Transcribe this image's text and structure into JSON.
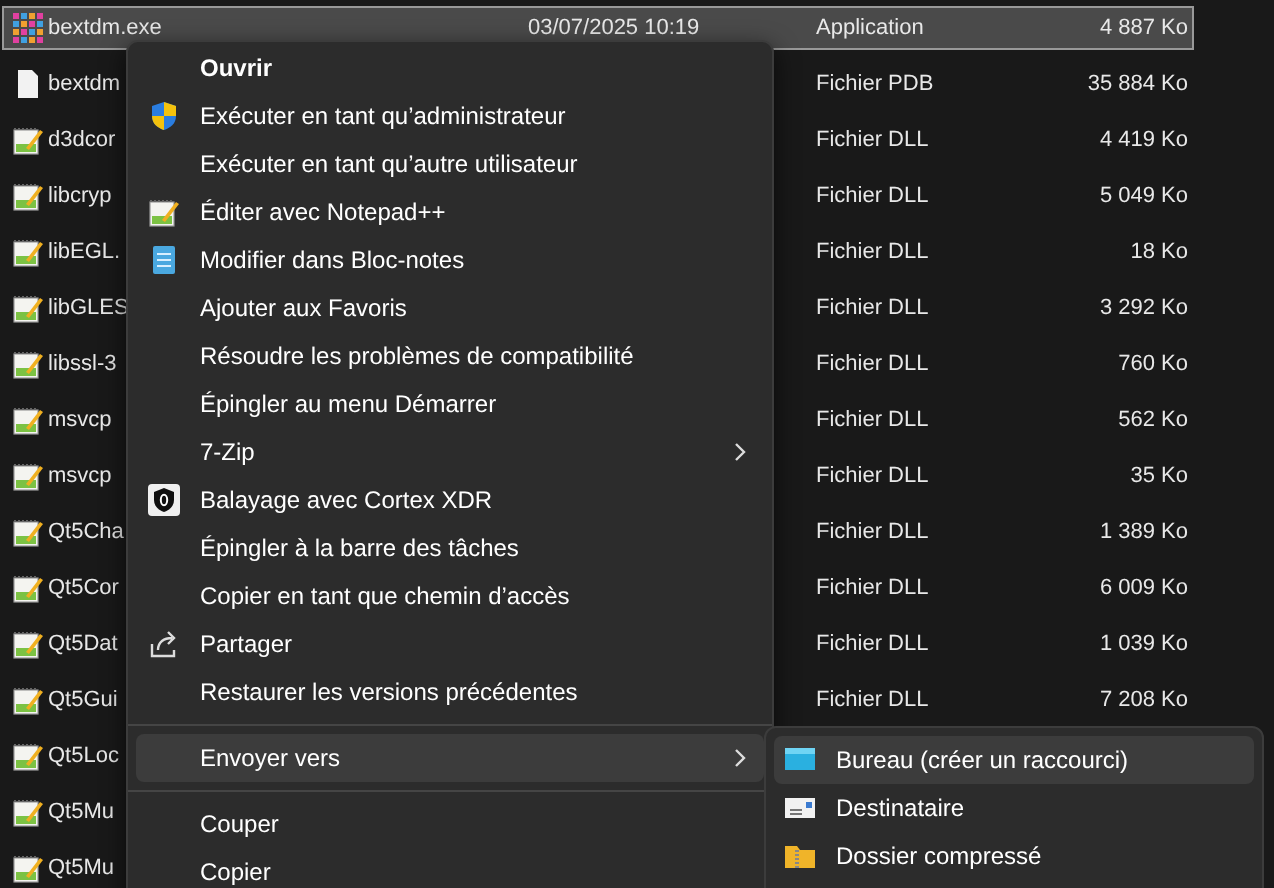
{
  "files": [
    {
      "kind": "exe",
      "name": "bextdm.exe",
      "date": "03/07/2025 10:19",
      "type": "Application",
      "size": "4 887 Ko",
      "selected": true
    },
    {
      "kind": "document",
      "name": "bextdm",
      "type": "Fichier PDB",
      "size": "35 884 Ko",
      "selected": false
    },
    {
      "kind": "notepadpp",
      "name": "d3dcor",
      "type": "Fichier DLL",
      "size": "4 419 Ko",
      "selected": false
    },
    {
      "kind": "notepadpp",
      "name": "libcryp",
      "type": "Fichier DLL",
      "size": "5 049 Ko",
      "selected": false
    },
    {
      "kind": "notepadpp",
      "name": "libEGL.",
      "type": "Fichier DLL",
      "size": "18 Ko",
      "selected": false
    },
    {
      "kind": "notepadpp",
      "name": "libGLES",
      "type": "Fichier DLL",
      "size": "3 292 Ko",
      "selected": false
    },
    {
      "kind": "notepadpp",
      "name": "libssl-3",
      "type": "Fichier DLL",
      "size": "760 Ko",
      "selected": false
    },
    {
      "kind": "notepadpp",
      "name": "msvcp",
      "type": "Fichier DLL",
      "size": "562 Ko",
      "selected": false
    },
    {
      "kind": "notepadpp",
      "name": "msvcp",
      "type": "Fichier DLL",
      "size": "35 Ko",
      "selected": false
    },
    {
      "kind": "notepadpp",
      "name": "Qt5Cha",
      "type": "Fichier DLL",
      "size": "1 389 Ko",
      "selected": false
    },
    {
      "kind": "notepadpp",
      "name": "Qt5Cor",
      "type": "Fichier DLL",
      "size": "6 009 Ko",
      "selected": false
    },
    {
      "kind": "notepadpp",
      "name": "Qt5Dat",
      "type": "Fichier DLL",
      "size": "1 039 Ko",
      "selected": false
    },
    {
      "kind": "notepadpp",
      "name": "Qt5Gui",
      "type": "Fichier DLL",
      "size": "7 208 Ko",
      "selected": false
    },
    {
      "kind": "notepadpp",
      "name": "Qt5Loc",
      "selected": false
    },
    {
      "kind": "notepadpp",
      "name": "Qt5Mu",
      "selected": false
    },
    {
      "kind": "notepadpp",
      "name": "Qt5Mu",
      "selected": false
    }
  ],
  "context_menu": {
    "items": [
      {
        "kind": "plain",
        "label": "Ouvrir",
        "default": true,
        "selected": false
      },
      {
        "kind": "shield",
        "label": "Exécuter en tant qu’administrateur",
        "default": false,
        "selected": false
      },
      {
        "kind": "plain",
        "label": "Exécuter en tant qu’autre utilisateur",
        "default": false,
        "selected": false
      },
      {
        "kind": "notepadpp",
        "label": "Éditer avec Notepad++",
        "default": false,
        "selected": false
      },
      {
        "kind": "notepad",
        "label": "Modifier dans Bloc-notes",
        "default": false,
        "selected": false
      },
      {
        "kind": "plain",
        "label": "Ajouter aux Favoris",
        "default": false,
        "selected": false
      },
      {
        "kind": "plain",
        "label": "Résoudre les problèmes de compatibilité",
        "default": false,
        "selected": false
      },
      {
        "kind": "plain",
        "label": "Épingler au menu Démarrer",
        "default": false,
        "selected": false
      },
      {
        "kind": "plain",
        "label": "7-Zip",
        "submenu": true,
        "default": false,
        "selected": false
      },
      {
        "kind": "cortex",
        "label": "Balayage avec Cortex XDR",
        "default": false,
        "selected": false
      },
      {
        "kind": "plain",
        "label": "Épingler à la barre des tâches",
        "default": false,
        "selected": false
      },
      {
        "kind": "plain",
        "label": "Copier en tant que chemin d’accès",
        "default": false,
        "selected": false
      },
      {
        "kind": "share",
        "label": "Partager",
        "default": false,
        "selected": false
      },
      {
        "kind": "plain",
        "label": "Restaurer les versions précédentes",
        "default": false,
        "selected": false
      },
      {
        "kind": "separator"
      },
      {
        "kind": "plain",
        "label": "Envoyer vers",
        "submenu": true,
        "default": false,
        "selected": true
      },
      {
        "kind": "separator"
      },
      {
        "kind": "plain",
        "label": "Couper",
        "default": false,
        "selected": false
      },
      {
        "kind": "plain",
        "label": "Copier",
        "default": false,
        "selected": false
      }
    ]
  },
  "send_to_menu": {
    "items": [
      {
        "kind": "desktop",
        "label": "Bureau (créer un raccourci)",
        "selected": true
      },
      {
        "kind": "mail",
        "label": "Destinataire",
        "selected": false
      },
      {
        "kind": "zip-folder",
        "label": "Dossier compressé",
        "selected": false
      }
    ]
  }
}
